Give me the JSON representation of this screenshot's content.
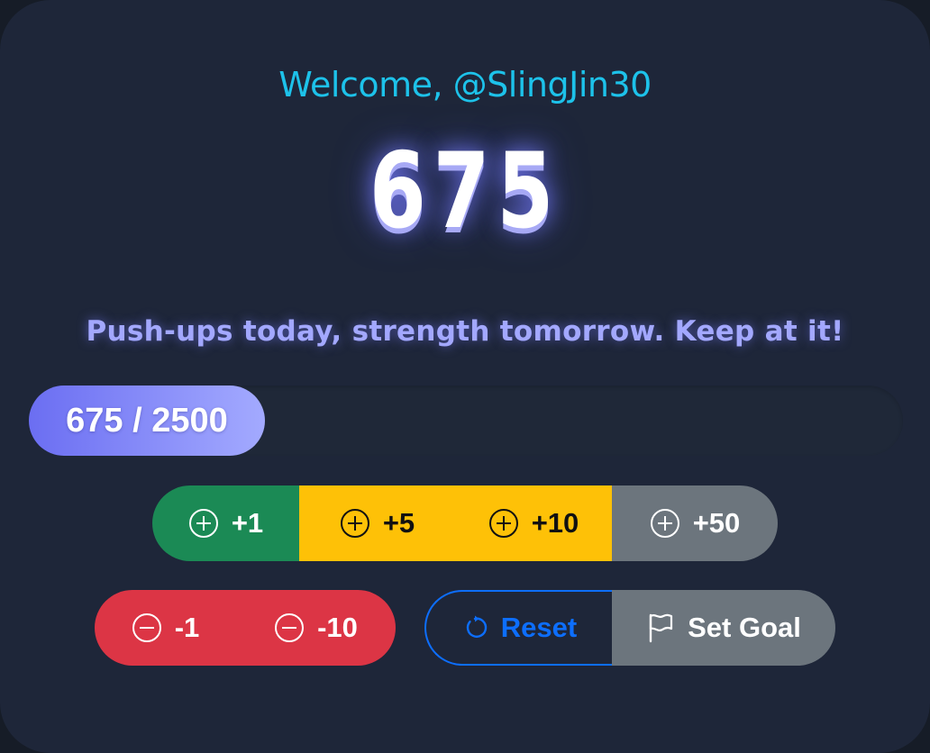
{
  "header": {
    "welcome_text": "Welcome, @SlingJin30"
  },
  "counter": {
    "value": "675"
  },
  "motto": "Push-ups today, strength tomorrow. Keep at it!",
  "progress": {
    "label": "675 / 2500",
    "current": 675,
    "goal": 2500,
    "display_fraction": 0.27,
    "fill_colors": [
      "#6b6ef2",
      "#a3aaff"
    ]
  },
  "increment_buttons": [
    {
      "label": "+1",
      "icon": "plus-circle-icon",
      "color": "#1b8a55"
    },
    {
      "label": "+5",
      "icon": "plus-circle-icon",
      "color": "#fec107"
    },
    {
      "label": "+10",
      "icon": "plus-circle-icon",
      "color": "#fec107"
    },
    {
      "label": "+50",
      "icon": "plus-circle-icon",
      "color": "#6c757d"
    }
  ],
  "decrement_buttons": [
    {
      "label": "-1",
      "icon": "minus-circle-icon",
      "color": "#dc3545"
    },
    {
      "label": "-10",
      "icon": "minus-circle-icon",
      "color": "#dc3545"
    }
  ],
  "actions": {
    "reset_label": "Reset",
    "reset_icon": "reset-arrow-icon",
    "reset_color": "#0d6efd",
    "set_goal_label": "Set Goal",
    "set_goal_icon": "flag-icon",
    "set_goal_color": "#6c757d"
  },
  "colors": {
    "background": "#1e2639",
    "welcome": "#1dc2ea",
    "motto": "#a3a8ff"
  }
}
